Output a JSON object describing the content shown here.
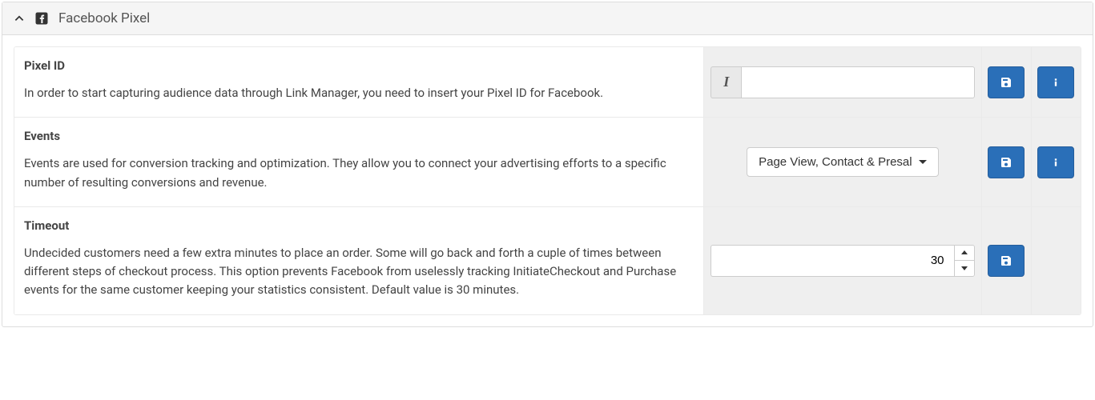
{
  "panel": {
    "title": "Facebook Pixel"
  },
  "rows": {
    "pixel_id": {
      "label": "Pixel ID",
      "help": "In order to start capturing audience data through Link Manager, you need to insert your Pixel ID for Facebook.",
      "value": "",
      "addon_symbol": "I"
    },
    "events": {
      "label": "Events",
      "help": "Events are used for conversion tracking and optimization. They allow you to connect your advertising efforts to a specific number of resulting conversions and revenue.",
      "selected": "Page View, Contact & Presal"
    },
    "timeout": {
      "label": "Timeout",
      "help": "Undecided customers need a few extra minutes to place an order. Some will go back and forth a cuple of times between different steps of checkout process. This option prevents Facebook from uselessly tracking InitiateCheckout and Purchase events for the same customer keeping your statistics consistent. Default value is 30 minutes.",
      "value": "30"
    }
  }
}
